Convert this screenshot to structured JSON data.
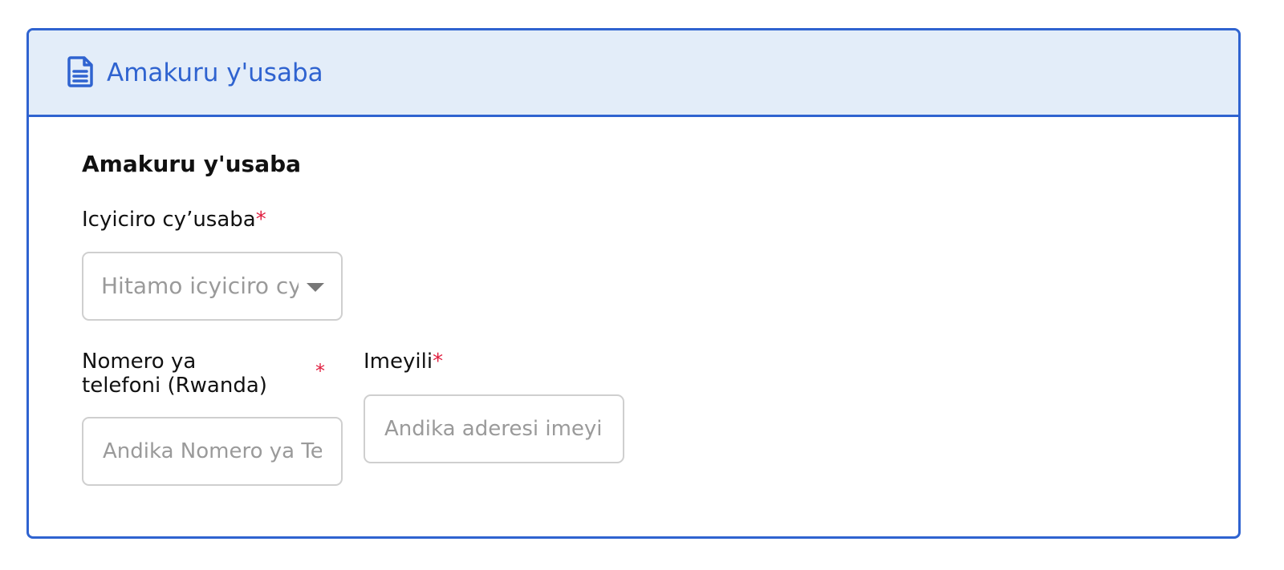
{
  "header": {
    "icon": "document-icon",
    "title": "Amakuru y'usaba"
  },
  "section": {
    "title": "Amakuru y'usaba"
  },
  "fields": {
    "category": {
      "label": "Icyiciro cy’usaba",
      "required_mark": "*",
      "placeholder": "Hitamo icyiciro cy’usaba"
    },
    "phone": {
      "label": "Nomero ya telefoni (Rwanda)",
      "required_mark": "*",
      "placeholder": "Andika Nomero ya Telefoni"
    },
    "email": {
      "label": "Imeyili",
      "required_mark": "*",
      "placeholder": "Andika aderesi imeyili"
    }
  },
  "colors": {
    "accent": "#2f63d0",
    "header_bg": "#e3edf9",
    "required": "#e02040"
  }
}
